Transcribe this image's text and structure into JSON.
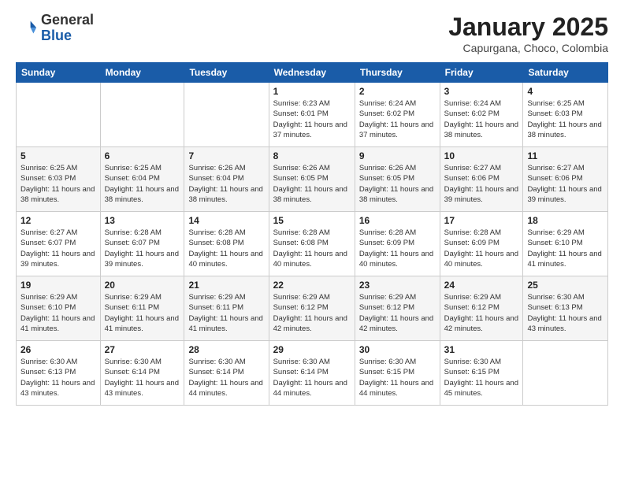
{
  "header": {
    "logo_general": "General",
    "logo_blue": "Blue",
    "month": "January 2025",
    "location": "Capurgana, Choco, Colombia"
  },
  "days_of_week": [
    "Sunday",
    "Monday",
    "Tuesday",
    "Wednesday",
    "Thursday",
    "Friday",
    "Saturday"
  ],
  "weeks": [
    [
      {
        "day": "",
        "info": ""
      },
      {
        "day": "",
        "info": ""
      },
      {
        "day": "",
        "info": ""
      },
      {
        "day": "1",
        "info": "Sunrise: 6:23 AM\nSunset: 6:01 PM\nDaylight: 11 hours\nand 37 minutes."
      },
      {
        "day": "2",
        "info": "Sunrise: 6:24 AM\nSunset: 6:02 PM\nDaylight: 11 hours\nand 37 minutes."
      },
      {
        "day": "3",
        "info": "Sunrise: 6:24 AM\nSunset: 6:02 PM\nDaylight: 11 hours\nand 38 minutes."
      },
      {
        "day": "4",
        "info": "Sunrise: 6:25 AM\nSunset: 6:03 PM\nDaylight: 11 hours\nand 38 minutes."
      }
    ],
    [
      {
        "day": "5",
        "info": "Sunrise: 6:25 AM\nSunset: 6:03 PM\nDaylight: 11 hours\nand 38 minutes."
      },
      {
        "day": "6",
        "info": "Sunrise: 6:25 AM\nSunset: 6:04 PM\nDaylight: 11 hours\nand 38 minutes."
      },
      {
        "day": "7",
        "info": "Sunrise: 6:26 AM\nSunset: 6:04 PM\nDaylight: 11 hours\nand 38 minutes."
      },
      {
        "day": "8",
        "info": "Sunrise: 6:26 AM\nSunset: 6:05 PM\nDaylight: 11 hours\nand 38 minutes."
      },
      {
        "day": "9",
        "info": "Sunrise: 6:26 AM\nSunset: 6:05 PM\nDaylight: 11 hours\nand 38 minutes."
      },
      {
        "day": "10",
        "info": "Sunrise: 6:27 AM\nSunset: 6:06 PM\nDaylight: 11 hours\nand 39 minutes."
      },
      {
        "day": "11",
        "info": "Sunrise: 6:27 AM\nSunset: 6:06 PM\nDaylight: 11 hours\nand 39 minutes."
      }
    ],
    [
      {
        "day": "12",
        "info": "Sunrise: 6:27 AM\nSunset: 6:07 PM\nDaylight: 11 hours\nand 39 minutes."
      },
      {
        "day": "13",
        "info": "Sunrise: 6:28 AM\nSunset: 6:07 PM\nDaylight: 11 hours\nand 39 minutes."
      },
      {
        "day": "14",
        "info": "Sunrise: 6:28 AM\nSunset: 6:08 PM\nDaylight: 11 hours\nand 40 minutes."
      },
      {
        "day": "15",
        "info": "Sunrise: 6:28 AM\nSunset: 6:08 PM\nDaylight: 11 hours\nand 40 minutes."
      },
      {
        "day": "16",
        "info": "Sunrise: 6:28 AM\nSunset: 6:09 PM\nDaylight: 11 hours\nand 40 minutes."
      },
      {
        "day": "17",
        "info": "Sunrise: 6:28 AM\nSunset: 6:09 PM\nDaylight: 11 hours\nand 40 minutes."
      },
      {
        "day": "18",
        "info": "Sunrise: 6:29 AM\nSunset: 6:10 PM\nDaylight: 11 hours\nand 41 minutes."
      }
    ],
    [
      {
        "day": "19",
        "info": "Sunrise: 6:29 AM\nSunset: 6:10 PM\nDaylight: 11 hours\nand 41 minutes."
      },
      {
        "day": "20",
        "info": "Sunrise: 6:29 AM\nSunset: 6:11 PM\nDaylight: 11 hours\nand 41 minutes."
      },
      {
        "day": "21",
        "info": "Sunrise: 6:29 AM\nSunset: 6:11 PM\nDaylight: 11 hours\nand 41 minutes."
      },
      {
        "day": "22",
        "info": "Sunrise: 6:29 AM\nSunset: 6:12 PM\nDaylight: 11 hours\nand 42 minutes."
      },
      {
        "day": "23",
        "info": "Sunrise: 6:29 AM\nSunset: 6:12 PM\nDaylight: 11 hours\nand 42 minutes."
      },
      {
        "day": "24",
        "info": "Sunrise: 6:29 AM\nSunset: 6:12 PM\nDaylight: 11 hours\nand 42 minutes."
      },
      {
        "day": "25",
        "info": "Sunrise: 6:30 AM\nSunset: 6:13 PM\nDaylight: 11 hours\nand 43 minutes."
      }
    ],
    [
      {
        "day": "26",
        "info": "Sunrise: 6:30 AM\nSunset: 6:13 PM\nDaylight: 11 hours\nand 43 minutes."
      },
      {
        "day": "27",
        "info": "Sunrise: 6:30 AM\nSunset: 6:14 PM\nDaylight: 11 hours\nand 43 minutes."
      },
      {
        "day": "28",
        "info": "Sunrise: 6:30 AM\nSunset: 6:14 PM\nDaylight: 11 hours\nand 44 minutes."
      },
      {
        "day": "29",
        "info": "Sunrise: 6:30 AM\nSunset: 6:14 PM\nDaylight: 11 hours\nand 44 minutes."
      },
      {
        "day": "30",
        "info": "Sunrise: 6:30 AM\nSunset: 6:15 PM\nDaylight: 11 hours\nand 44 minutes."
      },
      {
        "day": "31",
        "info": "Sunrise: 6:30 AM\nSunset: 6:15 PM\nDaylight: 11 hours\nand 45 minutes."
      },
      {
        "day": "",
        "info": ""
      }
    ]
  ]
}
